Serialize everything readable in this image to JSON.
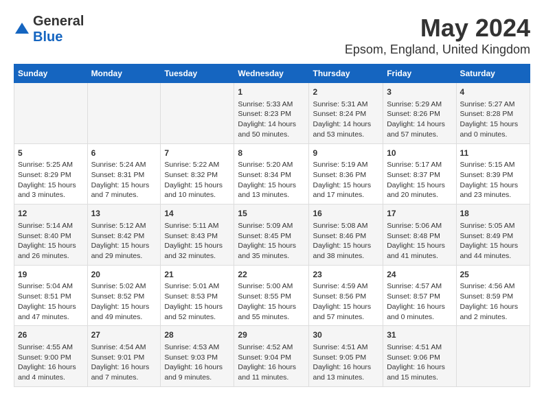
{
  "header": {
    "logo_general": "General",
    "logo_blue": "Blue",
    "month": "May 2024",
    "location": "Epsom, England, United Kingdom"
  },
  "weekdays": [
    "Sunday",
    "Monday",
    "Tuesday",
    "Wednesday",
    "Thursday",
    "Friday",
    "Saturday"
  ],
  "weeks": [
    [
      {
        "day": "",
        "info": ""
      },
      {
        "day": "",
        "info": ""
      },
      {
        "day": "",
        "info": ""
      },
      {
        "day": "1",
        "info": "Sunrise: 5:33 AM\nSunset: 8:23 PM\nDaylight: 14 hours\nand 50 minutes."
      },
      {
        "day": "2",
        "info": "Sunrise: 5:31 AM\nSunset: 8:24 PM\nDaylight: 14 hours\nand 53 minutes."
      },
      {
        "day": "3",
        "info": "Sunrise: 5:29 AM\nSunset: 8:26 PM\nDaylight: 14 hours\nand 57 minutes."
      },
      {
        "day": "4",
        "info": "Sunrise: 5:27 AM\nSunset: 8:28 PM\nDaylight: 15 hours\nand 0 minutes."
      }
    ],
    [
      {
        "day": "5",
        "info": "Sunrise: 5:25 AM\nSunset: 8:29 PM\nDaylight: 15 hours\nand 3 minutes."
      },
      {
        "day": "6",
        "info": "Sunrise: 5:24 AM\nSunset: 8:31 PM\nDaylight: 15 hours\nand 7 minutes."
      },
      {
        "day": "7",
        "info": "Sunrise: 5:22 AM\nSunset: 8:32 PM\nDaylight: 15 hours\nand 10 minutes."
      },
      {
        "day": "8",
        "info": "Sunrise: 5:20 AM\nSunset: 8:34 PM\nDaylight: 15 hours\nand 13 minutes."
      },
      {
        "day": "9",
        "info": "Sunrise: 5:19 AM\nSunset: 8:36 PM\nDaylight: 15 hours\nand 17 minutes."
      },
      {
        "day": "10",
        "info": "Sunrise: 5:17 AM\nSunset: 8:37 PM\nDaylight: 15 hours\nand 20 minutes."
      },
      {
        "day": "11",
        "info": "Sunrise: 5:15 AM\nSunset: 8:39 PM\nDaylight: 15 hours\nand 23 minutes."
      }
    ],
    [
      {
        "day": "12",
        "info": "Sunrise: 5:14 AM\nSunset: 8:40 PM\nDaylight: 15 hours\nand 26 minutes."
      },
      {
        "day": "13",
        "info": "Sunrise: 5:12 AM\nSunset: 8:42 PM\nDaylight: 15 hours\nand 29 minutes."
      },
      {
        "day": "14",
        "info": "Sunrise: 5:11 AM\nSunset: 8:43 PM\nDaylight: 15 hours\nand 32 minutes."
      },
      {
        "day": "15",
        "info": "Sunrise: 5:09 AM\nSunset: 8:45 PM\nDaylight: 15 hours\nand 35 minutes."
      },
      {
        "day": "16",
        "info": "Sunrise: 5:08 AM\nSunset: 8:46 PM\nDaylight: 15 hours\nand 38 minutes."
      },
      {
        "day": "17",
        "info": "Sunrise: 5:06 AM\nSunset: 8:48 PM\nDaylight: 15 hours\nand 41 minutes."
      },
      {
        "day": "18",
        "info": "Sunrise: 5:05 AM\nSunset: 8:49 PM\nDaylight: 15 hours\nand 44 minutes."
      }
    ],
    [
      {
        "day": "19",
        "info": "Sunrise: 5:04 AM\nSunset: 8:51 PM\nDaylight: 15 hours\nand 47 minutes."
      },
      {
        "day": "20",
        "info": "Sunrise: 5:02 AM\nSunset: 8:52 PM\nDaylight: 15 hours\nand 49 minutes."
      },
      {
        "day": "21",
        "info": "Sunrise: 5:01 AM\nSunset: 8:53 PM\nDaylight: 15 hours\nand 52 minutes."
      },
      {
        "day": "22",
        "info": "Sunrise: 5:00 AM\nSunset: 8:55 PM\nDaylight: 15 hours\nand 55 minutes."
      },
      {
        "day": "23",
        "info": "Sunrise: 4:59 AM\nSunset: 8:56 PM\nDaylight: 15 hours\nand 57 minutes."
      },
      {
        "day": "24",
        "info": "Sunrise: 4:57 AM\nSunset: 8:57 PM\nDaylight: 16 hours\nand 0 minutes."
      },
      {
        "day": "25",
        "info": "Sunrise: 4:56 AM\nSunset: 8:59 PM\nDaylight: 16 hours\nand 2 minutes."
      }
    ],
    [
      {
        "day": "26",
        "info": "Sunrise: 4:55 AM\nSunset: 9:00 PM\nDaylight: 16 hours\nand 4 minutes."
      },
      {
        "day": "27",
        "info": "Sunrise: 4:54 AM\nSunset: 9:01 PM\nDaylight: 16 hours\nand 7 minutes."
      },
      {
        "day": "28",
        "info": "Sunrise: 4:53 AM\nSunset: 9:03 PM\nDaylight: 16 hours\nand 9 minutes."
      },
      {
        "day": "29",
        "info": "Sunrise: 4:52 AM\nSunset: 9:04 PM\nDaylight: 16 hours\nand 11 minutes."
      },
      {
        "day": "30",
        "info": "Sunrise: 4:51 AM\nSunset: 9:05 PM\nDaylight: 16 hours\nand 13 minutes."
      },
      {
        "day": "31",
        "info": "Sunrise: 4:51 AM\nSunset: 9:06 PM\nDaylight: 16 hours\nand 15 minutes."
      },
      {
        "day": "",
        "info": ""
      }
    ]
  ]
}
